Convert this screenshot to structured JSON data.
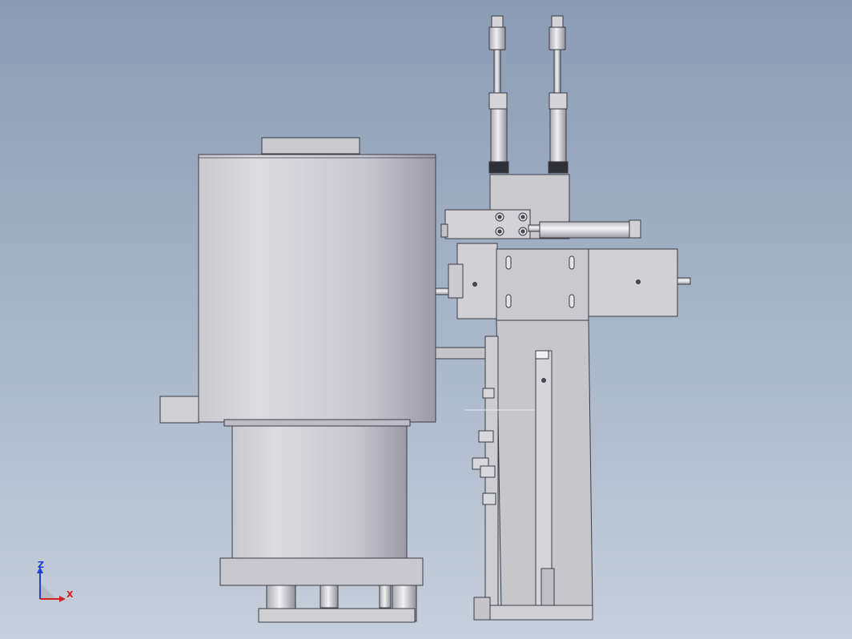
{
  "viewport": {
    "background_top": "#8a9bb4",
    "background_bottom": "#c6cfdb"
  },
  "colors": {
    "part_light": "#d9d9dd",
    "part_mid": "#c4c4c9",
    "part_dark": "#a9a7b2",
    "edge": "#3c3c44",
    "axis_z": "#1e3fd6",
    "axis_x": "#d42020"
  },
  "triad": {
    "z_label": "Z",
    "x_label": "X"
  }
}
